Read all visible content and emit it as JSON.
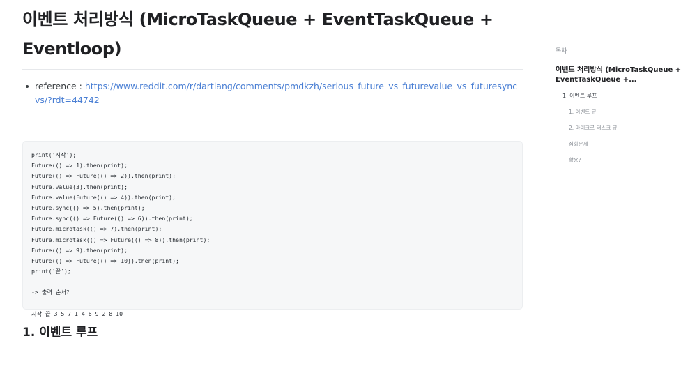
{
  "article": {
    "title": "이벤트 처리방식 (MicroTaskQueue + EventTaskQueue + Eventloop)",
    "reference_label": "reference : ",
    "reference_url": "https://www.reddit.com/r/dartlang/comments/pmdkzh/serious_future_vs_futurevalue_vs_futuresync_vs/?rdt=44742",
    "code_lines": [
      "print('시작');",
      "Future(() => 1).then(print);",
      "Future(() => Future(() => 2)).then(print);",
      "Future.value(3).then(print);",
      "Future.value(Future(() => 4)).then(print);",
      "Future.sync(() => 5).then(print);",
      "Future.sync(() => Future(() => 6)).then(print);",
      "Future.microtask(() => 7).then(print);",
      "Future.microtask(() => Future(() => 8)).then(print);",
      "Future(() => 9).then(print);",
      "Future(() => Future(() => 10)).then(print);",
      "print('끝');",
      "",
      "-> 출력 순서?",
      "",
      "시작 끝 3 5 7 1 4 6 9 2 8 10"
    ],
    "section_heading": "1. 이벤트 루프"
  },
  "toc": {
    "heading": "목차",
    "items": [
      {
        "level": 1,
        "label": "이벤트 처리방식 (MicroTaskQueue + EventTaskQueue +..."
      },
      {
        "level": 2,
        "label": "1. 이벤트 루프"
      },
      {
        "level": 3,
        "label": "1. 이벤트 큐"
      },
      {
        "level": 3,
        "label": "2. 마이크로 태스크 큐"
      },
      {
        "level": 3,
        "label": "심화문제"
      },
      {
        "level": 3,
        "label": "활용?"
      }
    ]
  }
}
